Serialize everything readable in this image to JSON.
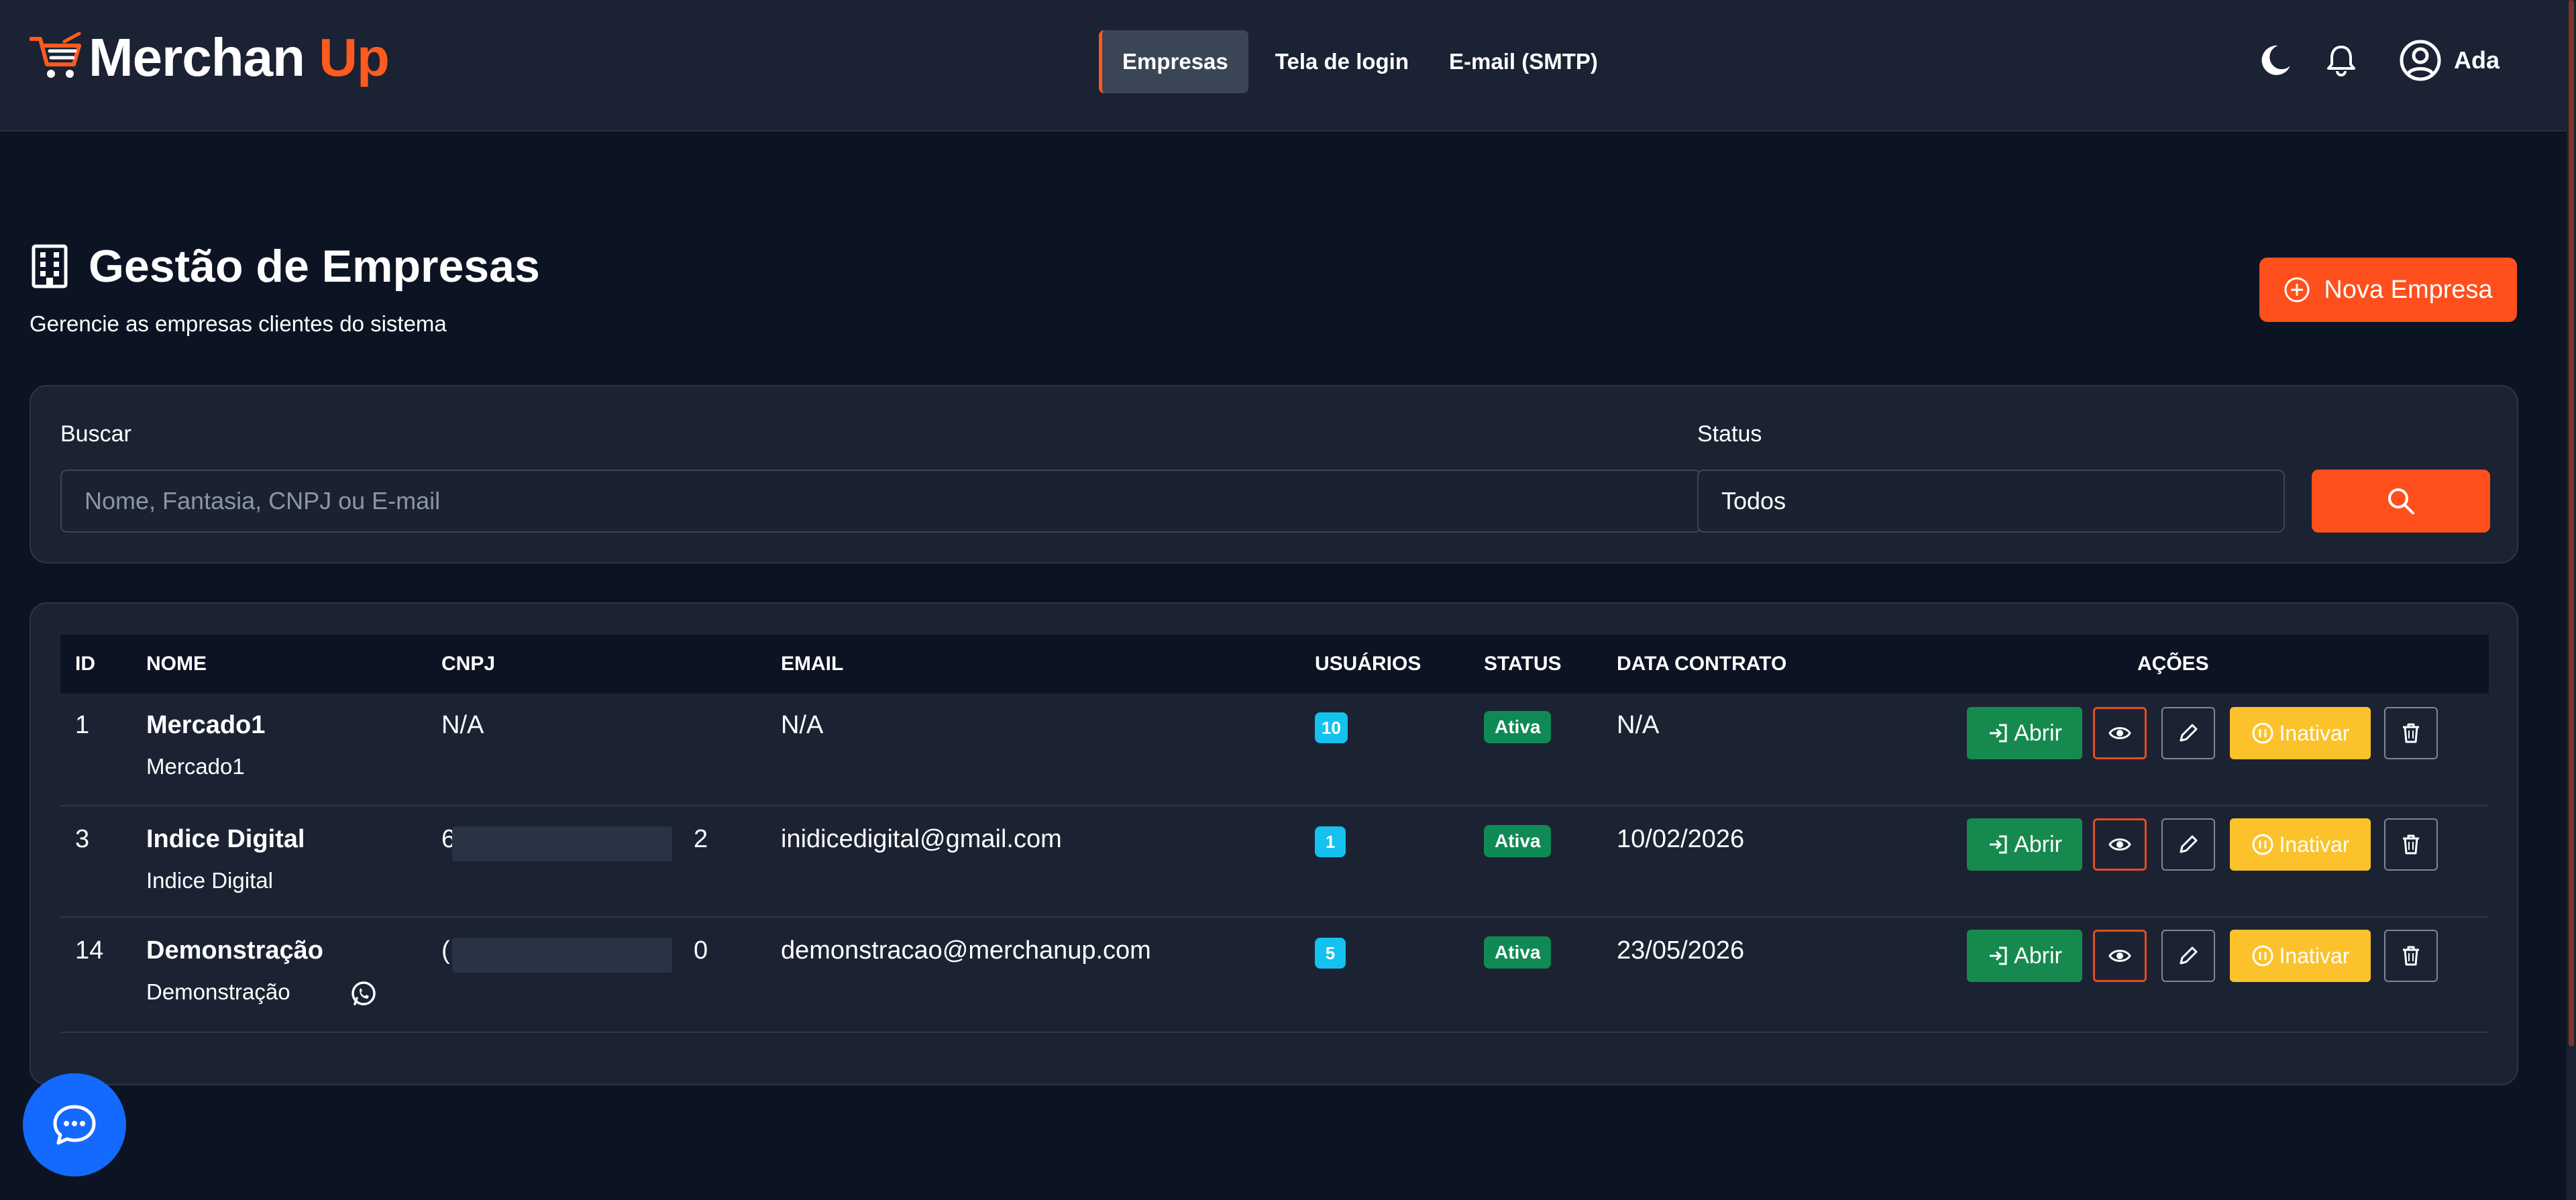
{
  "header": {
    "logo": {
      "word1": "Merchan",
      "word2": "Up"
    },
    "nav": [
      {
        "label": "Empresas",
        "active": true
      },
      {
        "label": "Tela de login",
        "active": false
      },
      {
        "label": "E-mail (SMTP)",
        "active": false
      }
    ],
    "icons": [
      "moon-icon",
      "bell-icon",
      "user-circle-icon"
    ],
    "user_name": "Ada"
  },
  "page": {
    "title": "Gestão de Empresas",
    "subtitle": "Gerencie as empresas clientes do sistema",
    "new_button": "Nova Empresa"
  },
  "filters": {
    "search_label": "Buscar",
    "search_placeholder": "Nome, Fantasia, CNPJ ou E-mail",
    "status_label": "Status",
    "status_value": "Todos"
  },
  "table": {
    "columns": [
      "ID",
      "NOME",
      "CNPJ",
      "EMAIL",
      "USUÁRIOS",
      "STATUS",
      "DATA CONTRATO",
      "AÇÕES"
    ],
    "rows": [
      {
        "id": "1",
        "name": "Mercado1",
        "fantasia": "Mercado1",
        "cnpj": "N/A",
        "cnpj_masked": false,
        "cnpj_start": "",
        "cnpj_end": "",
        "email": "N/A",
        "users": "10",
        "status": "Ativa",
        "date": "N/A",
        "whatsapp": false
      },
      {
        "id": "3",
        "name": "Indice Digital",
        "fantasia": "Indice Digital",
        "cnpj": "",
        "cnpj_masked": true,
        "cnpj_start": "6",
        "cnpj_end": "2",
        "email": "inidicedigital@gmail.com",
        "users": "1",
        "status": "Ativa",
        "date": "10/02/2026",
        "whatsapp": false
      },
      {
        "id": "14",
        "name": "Demonstração",
        "fantasia": "Demonstração",
        "cnpj": "",
        "cnpj_masked": true,
        "cnpj_start": "(",
        "cnpj_end": "0",
        "email": "demonstracao@merchanup.com",
        "users": "5",
        "status": "Ativa",
        "date": "23/05/2026",
        "whatsapp": true
      }
    ],
    "actions": {
      "open": "Abrir",
      "deactivate": "Inativar"
    }
  },
  "colors": {
    "accent": "#fe4f1c",
    "background": "#0c1424",
    "card": "#1b2333",
    "open_button": "#168a4e",
    "deactivate_button": "#fbc22b",
    "status_badge": "#0f8a55",
    "users_badge": "#14c1ef",
    "chat_fab": "#1469ff"
  }
}
